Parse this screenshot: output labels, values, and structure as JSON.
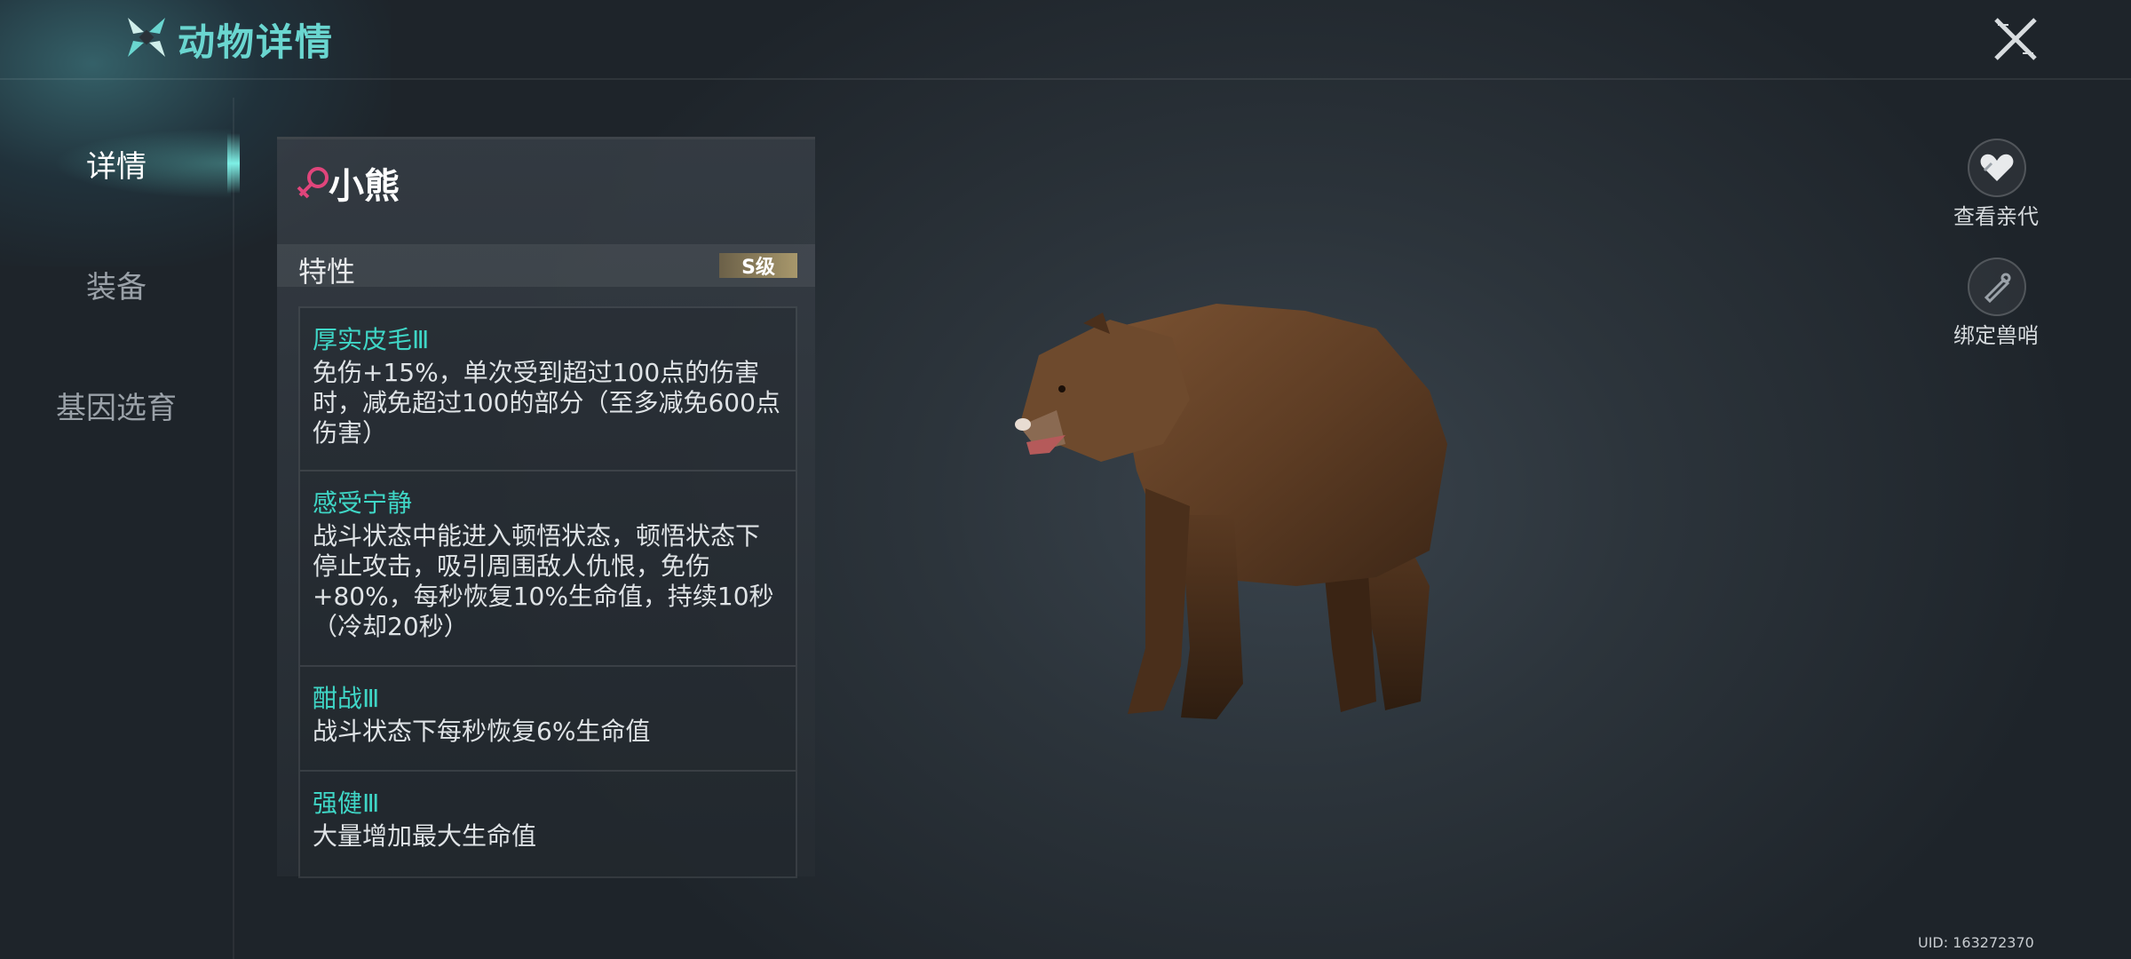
{
  "header": {
    "title": "动物详情"
  },
  "nav": {
    "items": [
      {
        "label": "详情",
        "active": true
      },
      {
        "label": "装备",
        "active": false
      },
      {
        "label": "基因选育",
        "active": false
      }
    ]
  },
  "animal": {
    "name": "小熊",
    "gender_icon": "female-icon",
    "trait_label": "特性",
    "grade": "S级",
    "traits": [
      {
        "name": "厚实皮毛Ⅲ",
        "desc": "免伤+15%，单次受到超过100点的伤害时，减免超过100的部分（至多减免600点伤害）"
      },
      {
        "name": "感受宁静",
        "desc": "战斗状态中能进入顿悟状态，顿悟状态下停止攻击，吸引周围敌人仇恨，免伤+80%，每秒恢复10%生命值，持续10秒（冷却20秒）"
      },
      {
        "name": "酣战Ⅲ",
        "desc": "战斗状态下每秒恢复6%生命值"
      },
      {
        "name": "强健Ⅲ",
        "desc": "大量增加最大生命值"
      }
    ]
  },
  "side_actions": [
    {
      "label": "查看亲代",
      "icon": "heart-icon"
    },
    {
      "label": "绑定兽哨",
      "icon": "whistle-icon"
    }
  ],
  "footer": {
    "uid": "UID: 163272370"
  },
  "colors": {
    "accent": "#6ad6d0",
    "trait_name": "#3fd6c6",
    "female": "#e0457b"
  }
}
